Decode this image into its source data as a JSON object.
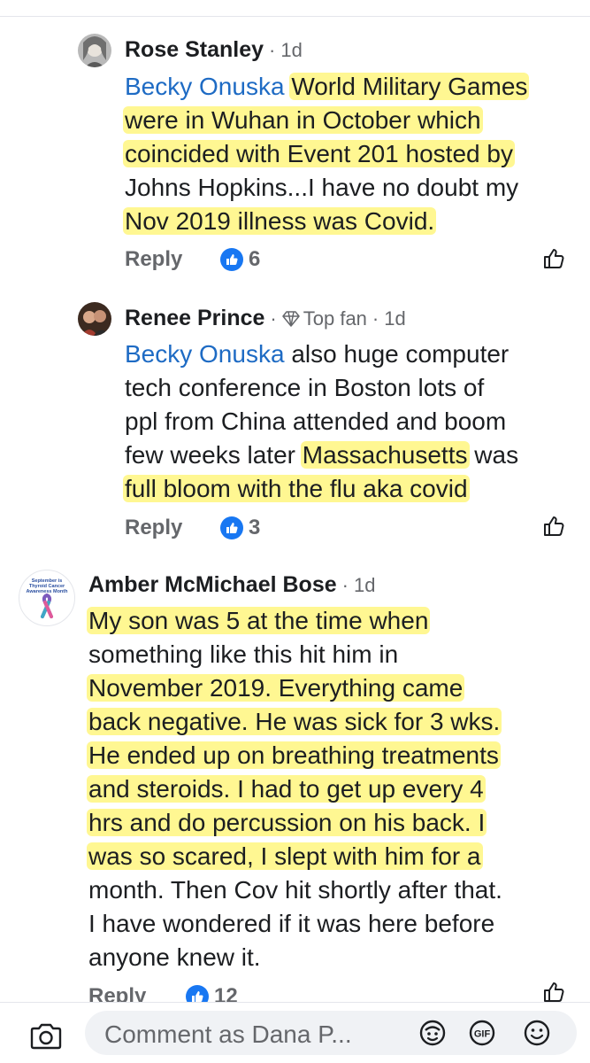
{
  "comments": [
    {
      "author": "Rose Stanley",
      "time": "1d",
      "mention": "Becky Onuska",
      "lines": [
        "World Military Games",
        "were in Wuhan in October which",
        "coincided with Event 201 hosted by",
        "Johns Hopkins...I have no doubt my",
        "Nov 2019 illness was Covid."
      ],
      "reply_label": "Reply",
      "likes": "6"
    },
    {
      "author": "Renee Prince",
      "badge": "Top fan",
      "time": "1d",
      "mention": "Becky Onuska",
      "lines": [
        "also huge computer",
        "tech conference in Boston lots of",
        "ppl from China attended and boom",
        "few weeks later",
        "Massachusetts",
        "was",
        "full bloom with the flu aka covid"
      ],
      "reply_label": "Reply",
      "likes": "3"
    },
    {
      "author": "Amber McMichael Bose",
      "time": "1d",
      "avatar_caption": "September is Thyroid Cancer Awareness Month",
      "lines": [
        "My son was 5 at the time when",
        "something like this hit him in",
        "November 2019. Everything came",
        "back negative.  He was sick for 3 wks.",
        "He ended up on breathing treatments",
        "and steroids. I had to get up every 4",
        "hrs and do percussion on his back. I",
        "was so scared, I slept with him for a",
        "month. Then Cov hit shortly after that.",
        "I have wondered if it was here before",
        "anyone knew it."
      ],
      "reply_label": "Reply",
      "likes": "12"
    }
  ],
  "composer": {
    "placeholder": "Comment as Dana P...",
    "icons": [
      "camera-icon",
      "avatar-sticker-icon",
      "gif-icon",
      "emoji-icon"
    ]
  },
  "colors": {
    "mention": "#1e6bc4",
    "like_blue": "#1877f2",
    "highlight": "#fff46e",
    "secondary_text": "#65676b"
  }
}
